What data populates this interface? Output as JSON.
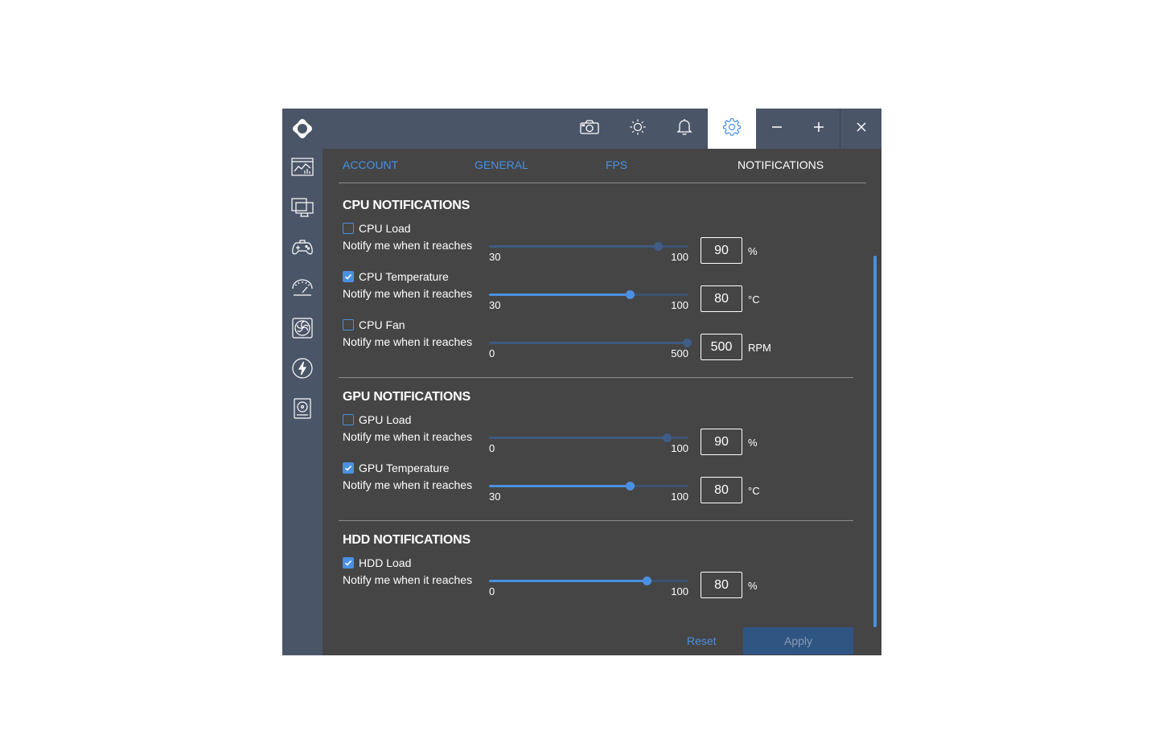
{
  "colors": {
    "accent": "#4a90e2",
    "titlebar": "#4b5568",
    "panel": "#454545"
  },
  "titlebar": {
    "icons": [
      "camera-icon",
      "brightness-icon",
      "bell-icon",
      "gear-icon",
      "minimize-icon",
      "maximize-icon",
      "close-icon"
    ],
    "active": "gear-icon"
  },
  "sidebar": {
    "items": [
      "monitoring-icon",
      "desktop-icon",
      "gamepad-icon",
      "speedometer-icon",
      "fan-icon",
      "power-icon",
      "hdd-icon"
    ]
  },
  "tabs": [
    {
      "label": "ACCOUNT"
    },
    {
      "label": "GENERAL"
    },
    {
      "label": "FPS"
    },
    {
      "label": "NOTIFICATIONS",
      "active": true
    }
  ],
  "sections": {
    "cpu": {
      "title": "CPU NOTIFICATIONS",
      "items": [
        {
          "label": "CPU Load",
          "checked": false,
          "notify": "Notify me when it reaches",
          "min": "30",
          "max": "100",
          "value": "90",
          "unit": "%"
        },
        {
          "label": "CPU Temperature",
          "checked": true,
          "notify": "Notify me when it reaches",
          "min": "30",
          "max": "100",
          "value": "80",
          "unit": "°C"
        },
        {
          "label": "CPU Fan",
          "checked": false,
          "notify": "Notify me when it reaches",
          "min": "0",
          "max": "500",
          "value": "500",
          "unit": "RPM"
        }
      ]
    },
    "gpu": {
      "title": "GPU NOTIFICATIONS",
      "items": [
        {
          "label": "GPU Load",
          "checked": false,
          "notify": "Notify me when it reaches",
          "min": "0",
          "max": "100",
          "value": "90",
          "unit": "%"
        },
        {
          "label": "GPU Temperature",
          "checked": true,
          "notify": "Notify me when it reaches",
          "min": "30",
          "max": "100",
          "value": "80",
          "unit": "°C"
        }
      ]
    },
    "hdd": {
      "title": "HDD NOTIFICATIONS",
      "items": [
        {
          "label": "HDD Load",
          "checked": true,
          "notify": "Notify me when it reaches",
          "min": "0",
          "max": "100",
          "value": "80",
          "unit": "%"
        }
      ]
    }
  },
  "footer": {
    "reset_label": "Reset",
    "apply_label": "Apply"
  }
}
